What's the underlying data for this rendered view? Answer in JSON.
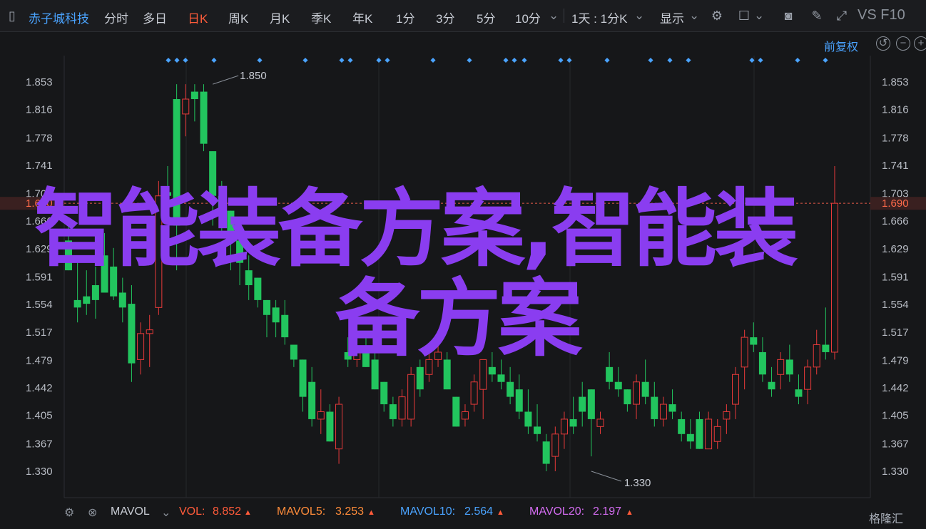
{
  "toolbar": {
    "stock_name": "赤子城科技",
    "periods": [
      "分时",
      "多日",
      "日K",
      "周K",
      "月K",
      "季K",
      "年K",
      "1分",
      "3分",
      "5分",
      "10分"
    ],
    "active_period": "日K",
    "range_label": "1天 : 1分K",
    "display_label": "显示",
    "vs_label": "VS F10"
  },
  "sub_bar": {
    "adjust_label": "前复权"
  },
  "chart_data": {
    "type": "candlestick",
    "title": "",
    "y_ticks": [
      1.853,
      1.816,
      1.778,
      1.741,
      1.703,
      1.666,
      1.629,
      1.591,
      1.554,
      1.517,
      1.479,
      1.442,
      1.405,
      1.367,
      1.33
    ],
    "y_tick_labels": [
      "1.853",
      "1.816",
      "1.778",
      "1.741",
      "1.703",
      "1.666",
      "1.629",
      "1.591",
      "1.554",
      "1.517",
      "1.479",
      "1.442",
      "1.405",
      "1.367",
      "1.330"
    ],
    "ylim": [
      1.3,
      1.87
    ],
    "current_price": 1.69,
    "current_price_label": "1.690",
    "high_annotation": {
      "label": "1.850",
      "value": 1.85,
      "bar": 16
    },
    "low_annotation": {
      "label": "1.330",
      "value": 1.33,
      "bar": 58
    },
    "candles": [
      {
        "o": 1.64,
        "h": 1.66,
        "l": 1.6,
        "c": 1.6
      },
      {
        "o": 1.56,
        "h": 1.61,
        "l": 1.53,
        "c": 1.55
      },
      {
        "o": 1.565,
        "h": 1.6,
        "l": 1.54,
        "c": 1.555
      },
      {
        "o": 1.58,
        "h": 1.605,
        "l": 1.535,
        "c": 1.56
      },
      {
        "o": 1.62,
        "h": 1.65,
        "l": 1.59,
        "c": 1.57
      },
      {
        "o": 1.605,
        "h": 1.63,
        "l": 1.56,
        "c": 1.565
      },
      {
        "o": 1.57,
        "h": 1.59,
        "l": 1.53,
        "c": 1.55
      },
      {
        "o": 1.555,
        "h": 1.58,
        "l": 1.45,
        "c": 1.475
      },
      {
        "o": 1.48,
        "h": 1.53,
        "l": 1.46,
        "c": 1.515
      },
      {
        "o": 1.515,
        "h": 1.54,
        "l": 1.47,
        "c": 1.52
      },
      {
        "o": 1.55,
        "h": 1.72,
        "l": 1.54,
        "c": 1.7
      },
      {
        "o": 1.705,
        "h": 1.74,
        "l": 1.68,
        "c": 1.7
      },
      {
        "o": 1.83,
        "h": 1.85,
        "l": 1.6,
        "c": 1.66
      },
      {
        "o": 1.81,
        "h": 1.85,
        "l": 1.78,
        "c": 1.83
      },
      {
        "o": 1.84,
        "h": 1.85,
        "l": 1.8,
        "c": 1.83
      },
      {
        "o": 1.84,
        "h": 1.85,
        "l": 1.76,
        "c": 1.77
      },
      {
        "o": 1.76,
        "h": 1.76,
        "l": 1.66,
        "c": 1.7
      },
      {
        "o": 1.7,
        "h": 1.72,
        "l": 1.65,
        "c": 1.68
      },
      {
        "o": 1.68,
        "h": 1.68,
        "l": 1.6,
        "c": 1.64
      },
      {
        "o": 1.64,
        "h": 1.64,
        "l": 1.58,
        "c": 1.61
      },
      {
        "o": 1.6,
        "h": 1.62,
        "l": 1.56,
        "c": 1.58
      },
      {
        "o": 1.59,
        "h": 1.59,
        "l": 1.55,
        "c": 1.56
      },
      {
        "o": 1.56,
        "h": 1.56,
        "l": 1.51,
        "c": 1.54
      },
      {
        "o": 1.55,
        "h": 1.56,
        "l": 1.51,
        "c": 1.53
      },
      {
        "o": 1.54,
        "h": 1.56,
        "l": 1.5,
        "c": 1.51
      },
      {
        "o": 1.5,
        "h": 1.5,
        "l": 1.47,
        "c": 1.48
      },
      {
        "o": 1.48,
        "h": 1.48,
        "l": 1.41,
        "c": 1.43
      },
      {
        "o": 1.45,
        "h": 1.47,
        "l": 1.39,
        "c": 1.4
      },
      {
        "o": 1.4,
        "h": 1.44,
        "l": 1.38,
        "c": 1.41
      },
      {
        "o": 1.41,
        "h": 1.42,
        "l": 1.37,
        "c": 1.37
      },
      {
        "o": 1.36,
        "h": 1.43,
        "l": 1.34,
        "c": 1.42
      },
      {
        "o": 1.49,
        "h": 1.51,
        "l": 1.47,
        "c": 1.48
      },
      {
        "o": 1.48,
        "h": 1.5,
        "l": 1.47,
        "c": 1.49
      },
      {
        "o": 1.49,
        "h": 1.51,
        "l": 1.47,
        "c": 1.47
      },
      {
        "o": 1.48,
        "h": 1.5,
        "l": 1.44,
        "c": 1.44
      },
      {
        "o": 1.45,
        "h": 1.45,
        "l": 1.41,
        "c": 1.42
      },
      {
        "o": 1.42,
        "h": 1.43,
        "l": 1.39,
        "c": 1.4
      },
      {
        "o": 1.4,
        "h": 1.44,
        "l": 1.39,
        "c": 1.43
      },
      {
        "o": 1.4,
        "h": 1.47,
        "l": 1.39,
        "c": 1.46
      },
      {
        "o": 1.47,
        "h": 1.48,
        "l": 1.43,
        "c": 1.44
      },
      {
        "o": 1.46,
        "h": 1.49,
        "l": 1.45,
        "c": 1.48
      },
      {
        "o": 1.48,
        "h": 1.5,
        "l": 1.47,
        "c": 1.49
      },
      {
        "o": 1.48,
        "h": 1.49,
        "l": 1.44,
        "c": 1.44
      },
      {
        "o": 1.43,
        "h": 1.43,
        "l": 1.39,
        "c": 1.39
      },
      {
        "o": 1.4,
        "h": 1.42,
        "l": 1.39,
        "c": 1.41
      },
      {
        "o": 1.42,
        "h": 1.46,
        "l": 1.41,
        "c": 1.45
      },
      {
        "o": 1.44,
        "h": 1.47,
        "l": 1.4,
        "c": 1.48
      },
      {
        "o": 1.47,
        "h": 1.49,
        "l": 1.45,
        "c": 1.46
      },
      {
        "o": 1.46,
        "h": 1.48,
        "l": 1.44,
        "c": 1.45
      },
      {
        "o": 1.45,
        "h": 1.47,
        "l": 1.42,
        "c": 1.43
      },
      {
        "o": 1.44,
        "h": 1.46,
        "l": 1.4,
        "c": 1.41
      },
      {
        "o": 1.41,
        "h": 1.44,
        "l": 1.38,
        "c": 1.39
      },
      {
        "o": 1.39,
        "h": 1.42,
        "l": 1.37,
        "c": 1.38
      },
      {
        "o": 1.37,
        "h": 1.38,
        "l": 1.33,
        "c": 1.34
      },
      {
        "o": 1.35,
        "h": 1.39,
        "l": 1.33,
        "c": 1.38
      },
      {
        "o": 1.38,
        "h": 1.41,
        "l": 1.36,
        "c": 1.4
      },
      {
        "o": 1.4,
        "h": 1.43,
        "l": 1.38,
        "c": 1.39
      },
      {
        "o": 1.43,
        "h": 1.45,
        "l": 1.39,
        "c": 1.41
      },
      {
        "o": 1.44,
        "h": 1.44,
        "l": 1.35,
        "c": 1.4
      },
      {
        "o": 1.39,
        "h": 1.41,
        "l": 1.38,
        "c": 1.4
      },
      {
        "o": 1.47,
        "h": 1.49,
        "l": 1.44,
        "c": 1.45
      },
      {
        "o": 1.45,
        "h": 1.47,
        "l": 1.43,
        "c": 1.44
      },
      {
        "o": 1.44,
        "h": 1.44,
        "l": 1.41,
        "c": 1.42
      },
      {
        "o": 1.42,
        "h": 1.46,
        "l": 1.4,
        "c": 1.45
      },
      {
        "o": 1.45,
        "h": 1.48,
        "l": 1.42,
        "c": 1.43
      },
      {
        "o": 1.43,
        "h": 1.45,
        "l": 1.39,
        "c": 1.4
      },
      {
        "o": 1.4,
        "h": 1.43,
        "l": 1.39,
        "c": 1.42
      },
      {
        "o": 1.42,
        "h": 1.44,
        "l": 1.4,
        "c": 1.41
      },
      {
        "o": 1.4,
        "h": 1.41,
        "l": 1.37,
        "c": 1.38
      },
      {
        "o": 1.38,
        "h": 1.4,
        "l": 1.36,
        "c": 1.37
      },
      {
        "o": 1.4,
        "h": 1.41,
        "l": 1.36,
        "c": 1.36
      },
      {
        "o": 1.36,
        "h": 1.41,
        "l": 1.36,
        "c": 1.4
      },
      {
        "o": 1.37,
        "h": 1.4,
        "l": 1.36,
        "c": 1.39
      },
      {
        "o": 1.4,
        "h": 1.42,
        "l": 1.38,
        "c": 1.41
      },
      {
        "o": 1.42,
        "h": 1.47,
        "l": 1.4,
        "c": 1.46
      },
      {
        "o": 1.47,
        "h": 1.52,
        "l": 1.44,
        "c": 1.51
      },
      {
        "o": 1.51,
        "h": 1.53,
        "l": 1.49,
        "c": 1.5
      },
      {
        "o": 1.49,
        "h": 1.51,
        "l": 1.45,
        "c": 1.46
      },
      {
        "o": 1.45,
        "h": 1.47,
        "l": 1.43,
        "c": 1.44
      },
      {
        "o": 1.46,
        "h": 1.49,
        "l": 1.44,
        "c": 1.48
      },
      {
        "o": 1.48,
        "h": 1.5,
        "l": 1.45,
        "c": 1.46
      },
      {
        "o": 1.44,
        "h": 1.46,
        "l": 1.42,
        "c": 1.43
      },
      {
        "o": 1.44,
        "h": 1.48,
        "l": 1.42,
        "c": 1.47
      },
      {
        "o": 1.47,
        "h": 1.52,
        "l": 1.46,
        "c": 1.5
      },
      {
        "o": 1.5,
        "h": 1.55,
        "l": 1.48,
        "c": 1.49
      },
      {
        "o": 1.49,
        "h": 1.74,
        "l": 1.48,
        "c": 1.69
      }
    ],
    "up_color": "#e83a3a",
    "down_color": "#22c55e",
    "grid": true
  },
  "indicator_bar": {
    "mavol_label": "MAVOL",
    "vol": {
      "label": "VOL:",
      "value": "8.852"
    },
    "mavol5": {
      "label": "MAVOL5:",
      "value": "3.253"
    },
    "mavol10": {
      "label": "MAVOL10:",
      "value": "2.564"
    },
    "mavol20": {
      "label": "MAVOL20:",
      "value": "2.197"
    },
    "colors": {
      "vol": "#ff5b3a",
      "mavol5": "#ff8c3a",
      "mavol10": "#4aa3ff",
      "mavol20": "#d36cf0"
    }
  },
  "watermark": "格隆汇",
  "overlay_text": {
    "line1": "智能装备方案,智能装",
    "line2": "备方案"
  }
}
